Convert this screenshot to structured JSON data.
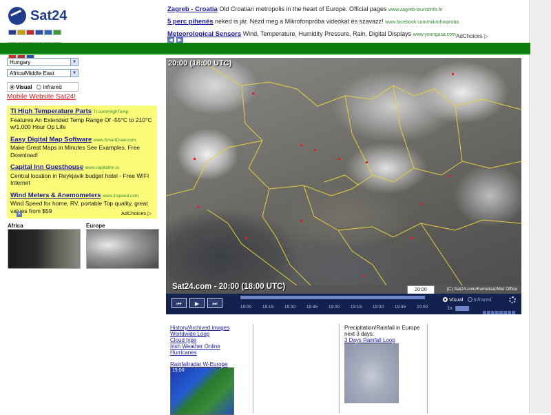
{
  "brand": {
    "name": "Sat24"
  },
  "flags": [
    {
      "name": "uk-flag",
      "color": "#2a3f8f"
    },
    {
      "name": "de-flag",
      "color": "#c9a000"
    },
    {
      "name": "nl-flag",
      "color": "#c03030"
    },
    {
      "name": "fr-flag",
      "color": "#3050b0"
    },
    {
      "name": "se-flag",
      "color": "#2e64b8"
    },
    {
      "name": "it-flag",
      "color": "#3a9a3a"
    },
    {
      "name": "fr2-flag",
      "color": "#4060c0"
    },
    {
      "name": "es-flag",
      "color": "#d8a020"
    },
    {
      "name": "es2-flag",
      "color": "#d04020"
    },
    {
      "name": "pt-flag",
      "color": "#2a8a2a"
    },
    {
      "name": "tr-flag",
      "color": "#d02020"
    },
    {
      "name": "cz-flag",
      "color": "#3050b0"
    },
    {
      "name": "pl-flag",
      "color": "#d03030"
    },
    {
      "name": "rs-flag",
      "color": "#b03030"
    },
    {
      "name": "hr-flag",
      "color": "#2a4fa0"
    }
  ],
  "top_ads": [
    {
      "title": "Zagreb - Croatia",
      "text": "Old Croatian metropolis in the heart of Europe. Official pages",
      "url": "www.zagreb-touristinfo.hr"
    },
    {
      "title": "5 perc pihenés",
      "text": "neked is jár. Nézd meg a Mikrofonpróba videókat és szavazz!",
      "url": "www.facebook.com/mikrofonproba"
    },
    {
      "title": "Meteorological Sensors",
      "text": "Wind, Temperature, Humidity Pressure, Rain, Digital Displays",
      "url": "www.youngusa.com"
    }
  ],
  "adchoices_label": "AdChoices",
  "selects": {
    "country": "Hungary",
    "region": "Africa/Middle East"
  },
  "radio": {
    "visual": "Visual",
    "infrared": "Infrared"
  },
  "mobile_link": "Mobile Website Sat24!",
  "left_ads": [
    {
      "title": "TI High Temperature Parts",
      "url": "TI.com/HighTemp",
      "text": "Features An Extended Temp Range Of -55°C to 210°C w/1,000 Hour Op Life"
    },
    {
      "title": "Easy Digital Map Software",
      "url": "www.SmartDraw.com",
      "text": "Make Great Maps in Minutes See Examples. Free Download!"
    },
    {
      "title": "Capital Inn Guesthouse",
      "url": "www.capitalinn.is",
      "text": "Central location in Reykjavik budget hotel - Free WIFI Internet"
    },
    {
      "title": "Wind Meters & Anemometers",
      "url": "www.inspeed.com",
      "text": "Wind Speed for home, RV, portable Top quality, great values from $59"
    }
  ],
  "thumbs": {
    "africa": "Africa",
    "europe": "Europe"
  },
  "map": {
    "time_top": "20:00 (18:00 UTC)",
    "caption": "Sat24.com - 20:00 (18:00 UTC)",
    "copyright": "(C) Sat24.com/Eumetsat/Met Office",
    "time_box": "20:00",
    "progress": 1.0
  },
  "controls": {
    "ticks": [
      "18:00",
      "18:15",
      "18:30",
      "18:45",
      "19:00",
      "19:15",
      "19:30",
      "19:45",
      "20:00"
    ],
    "visual": "Visual",
    "infrared": "Infrared",
    "speed": "1x"
  },
  "bottom_links": [
    "History/Archived images",
    "Worldwide Loop",
    "Cloud type",
    "Irish Weather Online",
    "Hurricanes"
  ],
  "rainfall": {
    "title": "Rainfallradar W-Europe",
    "time": "19:00"
  },
  "precip": {
    "line1": "Precipitation/Rainfall in Europe",
    "line2": "next 3 days:",
    "link": "3 Days Rainfall Loop"
  },
  "colors": {
    "accent_green": "#0d7d0d",
    "link": "#1a1aa6",
    "ad_bg": "#fbfb7a"
  }
}
